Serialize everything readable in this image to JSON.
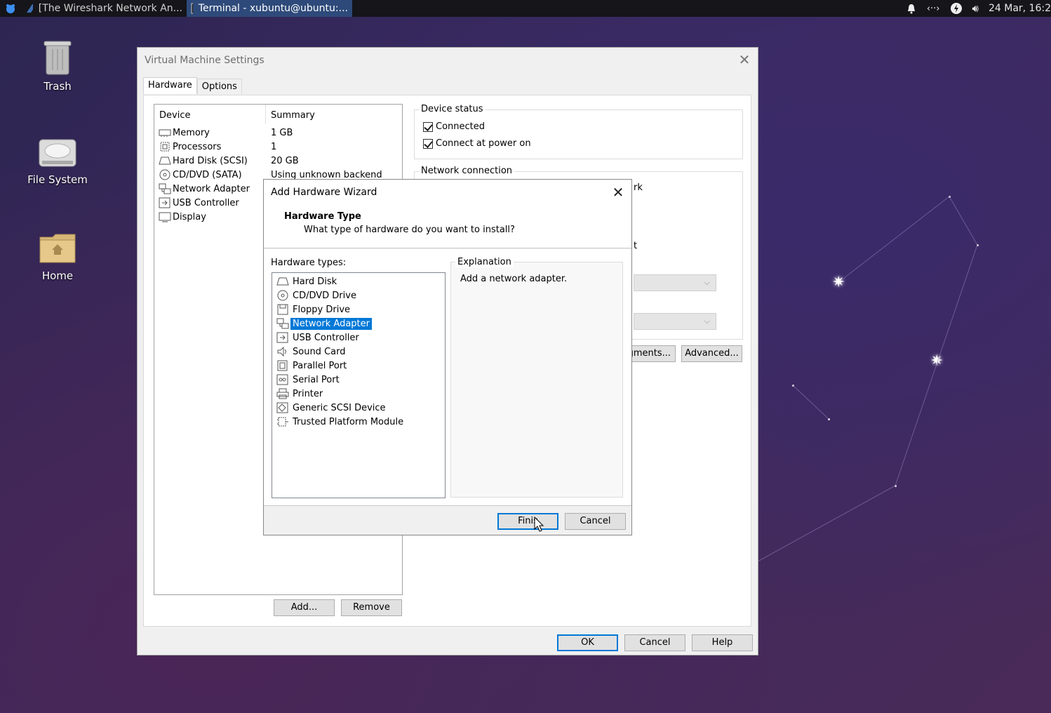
{
  "taskbar": {
    "tasks": [
      {
        "label": "[The Wireshark Network An...",
        "icon": "wireshark-icon"
      },
      {
        "label": "Terminal - xubuntu@ubuntu:...",
        "icon": "terminal-icon"
      }
    ],
    "clock": "24 Mar, 16:2",
    "tray_icons": [
      "notification-bell-icon",
      "network-icon",
      "power-icon",
      "volume-icon"
    ]
  },
  "desktop": {
    "icons": [
      {
        "label": "Trash",
        "icon": "trash-icon"
      },
      {
        "label": "File System",
        "icon": "drive-icon"
      },
      {
        "label": "Home",
        "icon": "home-folder-icon"
      }
    ]
  },
  "vm_settings": {
    "title": "Virtual Machine Settings",
    "tabs": [
      "Hardware",
      "Options"
    ],
    "device_list": {
      "headers": {
        "device": "Device",
        "summary": "Summary"
      },
      "rows": [
        {
          "device": "Memory",
          "summary": "1 GB",
          "icon": "memory-icon"
        },
        {
          "device": "Processors",
          "summary": "1",
          "icon": "processor-icon"
        },
        {
          "device": "Hard Disk (SCSI)",
          "summary": "20 GB",
          "icon": "hard-disk-icon"
        },
        {
          "device": "CD/DVD (SATA)",
          "summary": "Using unknown backend",
          "icon": "cd-dvd-icon"
        },
        {
          "device": "Network Adapter",
          "summary": "",
          "icon": "network-adapter-icon"
        },
        {
          "device": "USB Controller",
          "summary": "",
          "icon": "usb-icon"
        },
        {
          "device": "Display",
          "summary": "",
          "icon": "display-icon"
        }
      ]
    },
    "device_status": {
      "title": "Device status",
      "connected_label": "Connected",
      "connected_checked": true,
      "power_on_label": "Connect at power on",
      "power_on_checked": true
    },
    "network_connection": {
      "title": "Network connection",
      "partial_text_1": "rk",
      "partial_text_2": "t"
    },
    "buttons": {
      "segments": "gments...",
      "advanced": "Advanced...",
      "add": "Add...",
      "remove": "Remove",
      "ok": "OK",
      "cancel": "Cancel",
      "help": "Help"
    }
  },
  "wizard": {
    "title": "Add Hardware Wizard",
    "heading": "Hardware Type",
    "subheading": "What type of hardware do you want to install?",
    "hardware_types_label": "Hardware types:",
    "hardware_types": [
      {
        "label": "Hard Disk",
        "icon": "hard-disk-icon",
        "selected": false
      },
      {
        "label": "CD/DVD Drive",
        "icon": "cd-dvd-icon",
        "selected": false
      },
      {
        "label": "Floppy Drive",
        "icon": "floppy-icon",
        "selected": false
      },
      {
        "label": "Network Adapter",
        "icon": "network-adapter-icon",
        "selected": true
      },
      {
        "label": "USB Controller",
        "icon": "usb-icon",
        "selected": false
      },
      {
        "label": "Sound Card",
        "icon": "speaker-icon",
        "selected": false
      },
      {
        "label": "Parallel Port",
        "icon": "parallel-port-icon",
        "selected": false
      },
      {
        "label": "Serial Port",
        "icon": "serial-port-icon",
        "selected": false
      },
      {
        "label": "Printer",
        "icon": "printer-icon",
        "selected": false
      },
      {
        "label": "Generic SCSI Device",
        "icon": "scsi-icon",
        "selected": false
      },
      {
        "label": "Trusted Platform Module",
        "icon": "tpm-icon",
        "selected": false
      }
    ],
    "explanation_title": "Explanation",
    "explanation_text": "Add a network adapter.",
    "finish_label": "Finis",
    "cancel_label": "Cancel"
  },
  "colors": {
    "selection": "#0078d7",
    "taskbar": "#15151a",
    "active_task": "#2e4a7a"
  }
}
